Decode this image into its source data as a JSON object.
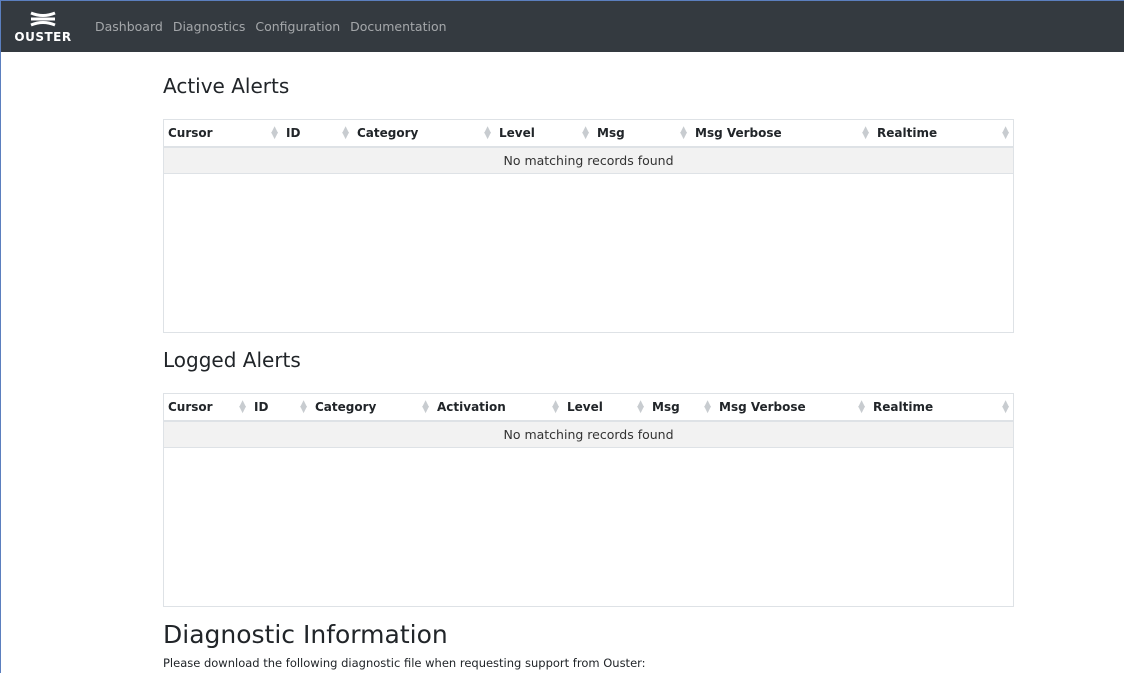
{
  "navbar": {
    "brand": "OUSTER",
    "links": [
      "Dashboard",
      "Diagnostics",
      "Configuration",
      "Documentation"
    ]
  },
  "active_alerts": {
    "title": "Active Alerts",
    "columns": [
      "Cursor",
      "ID",
      "Category",
      "Level",
      "Msg",
      "Msg Verbose",
      "Realtime"
    ],
    "empty_message": "No matching records found"
  },
  "logged_alerts": {
    "title": "Logged Alerts",
    "columns": [
      "Cursor",
      "ID",
      "Category",
      "Activation",
      "Level",
      "Msg",
      "Msg Verbose",
      "Realtime"
    ],
    "empty_message": "No matching records found"
  },
  "diagnostic": {
    "title": "Diagnostic Information",
    "text": "Please download the following diagnostic file when requesting support from Ouster:"
  }
}
